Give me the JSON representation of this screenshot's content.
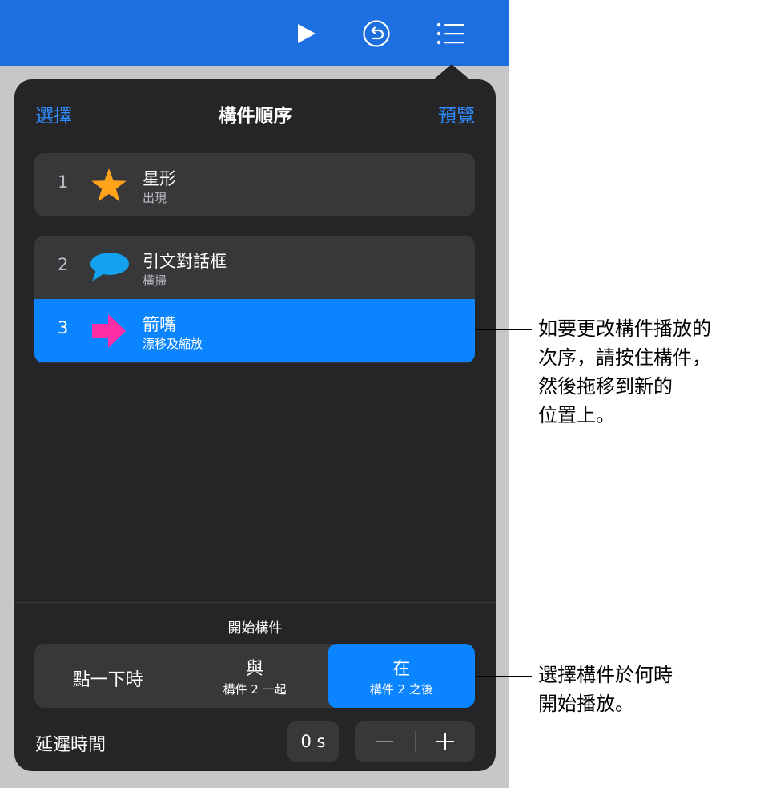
{
  "toolbar": {
    "play_icon": "play-icon",
    "undo_icon": "undo-icon",
    "list_icon": "list-icon",
    "color": "#1d6fe0"
  },
  "popover": {
    "left_button": "選擇",
    "title": "構件順序",
    "right_button": "預覽",
    "builds": [
      {
        "number": "1",
        "title": "星形",
        "subtitle": "出現",
        "icon": "star-icon",
        "icon_color": "#ffa31a",
        "selected": false
      },
      {
        "number": "2",
        "title": "引文對話框",
        "subtitle": "橫掃",
        "icon": "speech-bubble-icon",
        "icon_color": "#12a2f0",
        "selected": false
      },
      {
        "number": "3",
        "title": "箭嘴",
        "subtitle": "漂移及縮放",
        "icon": "arrow-icon",
        "icon_color": "#ff2ea6",
        "selected": true
      }
    ],
    "start_label": "開始構件",
    "start_options": [
      {
        "label": "點一下時",
        "sub": "",
        "selected": false
      },
      {
        "label": "與",
        "sub": "構件 2 一起",
        "selected": false
      },
      {
        "label": "在",
        "sub": "構件 2 之後",
        "selected": true
      }
    ],
    "delay_label": "延遲時間",
    "delay_value": "0 s",
    "accent_color": "#0a84ff"
  },
  "callouts": [
    {
      "text": "如要更改構件播放的\n次序，請按住構件，\n然後拖移到新的\n位置上。"
    },
    {
      "text": "選擇構件於何時\n開始播放。"
    }
  ]
}
